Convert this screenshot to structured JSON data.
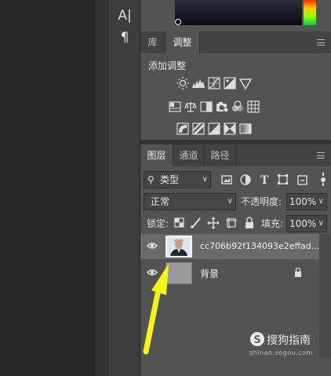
{
  "tools": {
    "type_tool_glyph": "A|",
    "paragraph_glyph": "¶"
  },
  "adjust_panel": {
    "tabs": [
      {
        "label": "库",
        "active": false
      },
      {
        "label": "调整",
        "active": true
      }
    ],
    "heading": "添加调整",
    "icons": [
      [
        "brightness-contrast-icon",
        "levels-icon",
        "curves-icon",
        "exposure-icon",
        "vibrance-icon"
      ],
      [
        "hue-saturation-icon",
        "color-balance-icon",
        "black-white-icon",
        "photo-filter-icon",
        "channel-mixer-icon",
        "color-lookup-icon"
      ],
      [
        "invert-icon",
        "posterize-icon",
        "threshold-icon",
        "selective-color-icon",
        "gradient-map-icon"
      ]
    ]
  },
  "layers_panel": {
    "tabs": [
      {
        "label": "图层",
        "active": true
      },
      {
        "label": "通道",
        "active": false
      },
      {
        "label": "路径",
        "active": false
      }
    ],
    "filter_kind": "类型",
    "blend_mode": "正常",
    "opacity_label": "不透明度:",
    "opacity_value": "100%",
    "lock_label": "锁定:",
    "fill_label": "填充:",
    "fill_value": "100%",
    "layers": [
      {
        "name": "cc706b92f134093e2effad...",
        "selected": true,
        "locked": false
      },
      {
        "name": "背景",
        "selected": false,
        "locked": true
      }
    ]
  },
  "watermark": {
    "brand": "搜狗指南",
    "url": "zhinan.sogou.com"
  },
  "colors": {
    "annotation_arrow": "#f5f51a",
    "panel_bg": "#535353",
    "selected_layer": "#6a6a6a"
  }
}
